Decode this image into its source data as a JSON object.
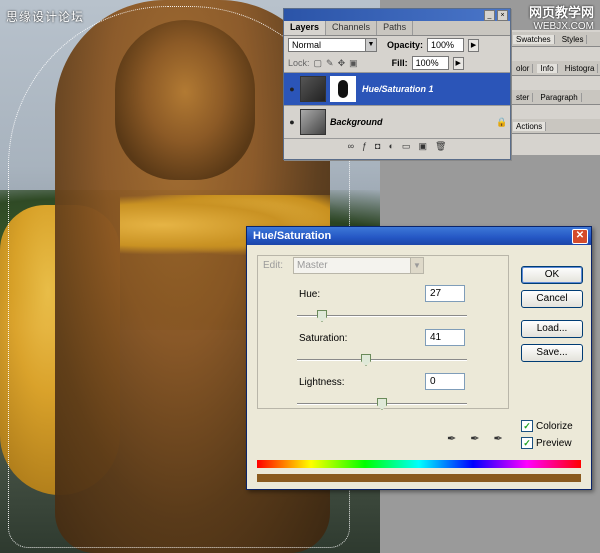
{
  "watermark": {
    "left": "思缘设计论坛",
    "right": "网页教学网",
    "right_sub": "WEBJX.COM"
  },
  "layers_panel": {
    "tabs": [
      {
        "label": "Layers",
        "active": true
      },
      {
        "label": "Channels",
        "active": false
      },
      {
        "label": "Paths",
        "active": false
      }
    ],
    "blend_mode": "Normal",
    "opacity_label": "Opacity:",
    "opacity_value": "100%",
    "lock_label": "Lock:",
    "fill_label": "Fill:",
    "fill_value": "100%",
    "layers": [
      {
        "name": "Hue/Saturation 1",
        "active": true
      },
      {
        "name": "Background",
        "active": false
      }
    ]
  },
  "side_panels": {
    "row1": [
      "Swatches",
      "Styles"
    ],
    "row2": [
      "olor",
      "Info",
      "Histogra"
    ],
    "row3": [
      "ster",
      "Paragraph"
    ],
    "row4": [
      "Actions"
    ]
  },
  "dialog": {
    "title": "Hue/Saturation",
    "edit_label": "Edit:",
    "edit_value": "Master",
    "hue_label": "Hue:",
    "hue_value": "27",
    "saturation_label": "Saturation:",
    "saturation_value": "41",
    "lightness_label": "Lightness:",
    "lightness_value": "0",
    "ok_label": "OK",
    "cancel_label": "Cancel",
    "load_label": "Load...",
    "save_label": "Save...",
    "colorize_label": "Colorize",
    "preview_label": "Preview",
    "colorize_checked": true,
    "preview_checked": true,
    "colors": {
      "spectrum_result": "#8a5a1e"
    }
  }
}
